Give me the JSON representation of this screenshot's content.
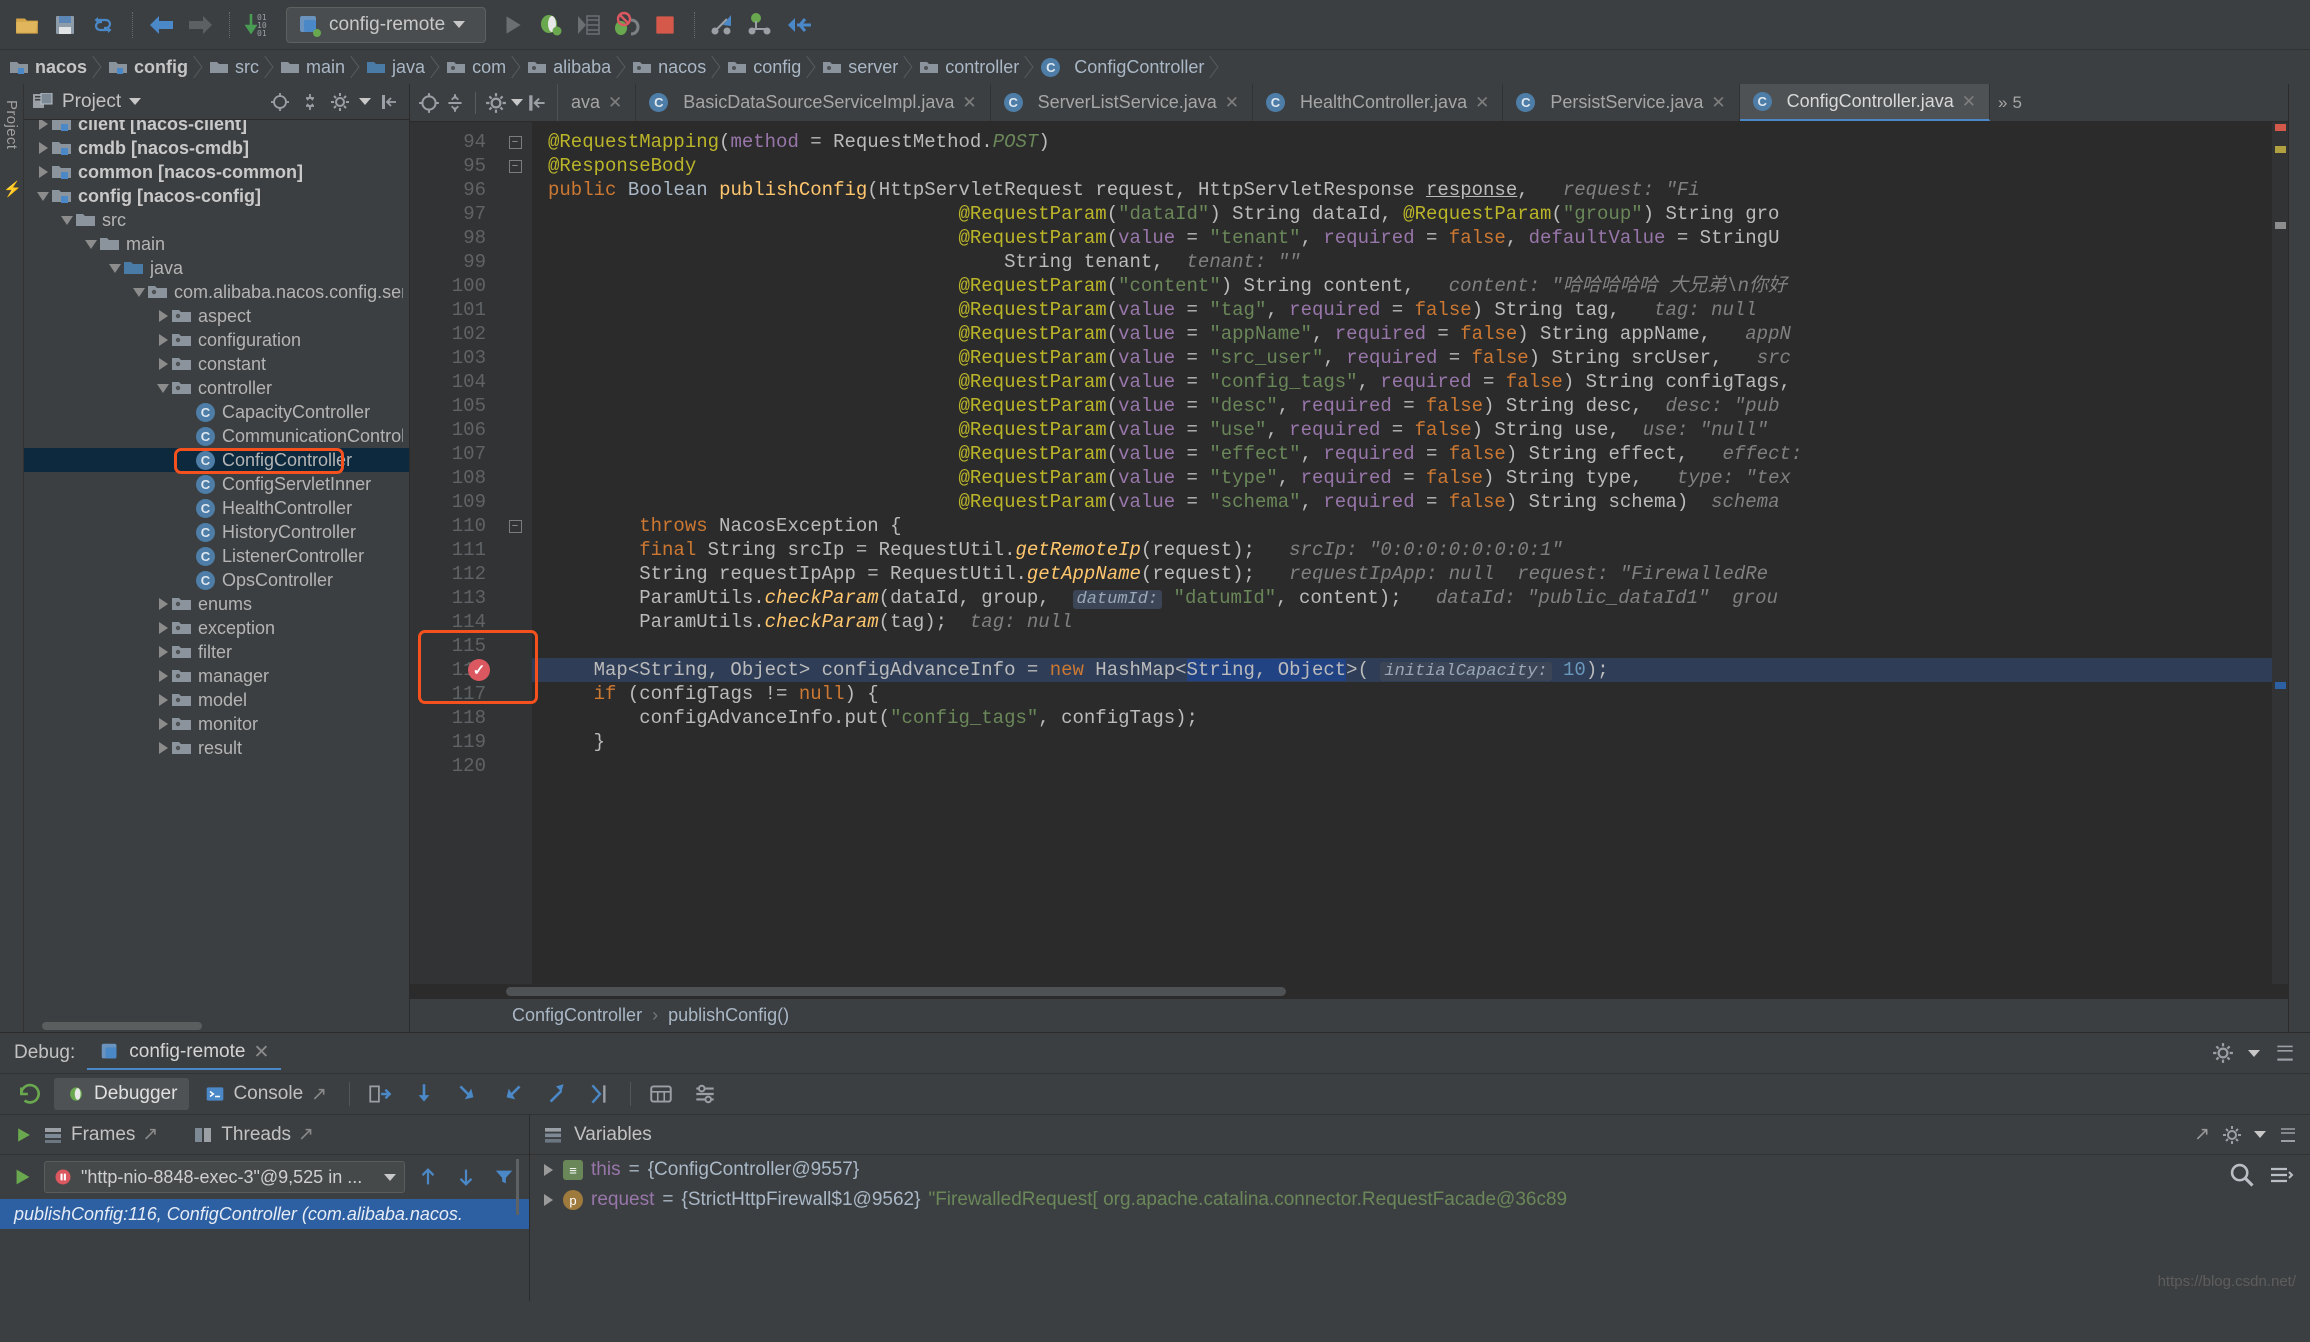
{
  "toolbar": {
    "run_config_label": "config-remote",
    "icons": [
      "open-folder-icon",
      "save-all-icon",
      "sync-icon",
      "back-icon",
      "forward-icon",
      "compile-icon",
      "run-config-selector",
      "run-icon",
      "debug-icon",
      "coverage-icon",
      "mute-breakpoints-icon",
      "stop-icon",
      "step-into-icon",
      "step-over-icon",
      "step-out-icon"
    ]
  },
  "breadcrumb": {
    "items": [
      {
        "label": "nacos",
        "icon": "module-folder-icon",
        "bold": true
      },
      {
        "label": "config",
        "icon": "module-folder-icon",
        "bold": true
      },
      {
        "label": "src",
        "icon": "folder-icon",
        "bold": false
      },
      {
        "label": "main",
        "icon": "folder-icon",
        "bold": false
      },
      {
        "label": "java",
        "icon": "source-folder-icon",
        "bold": false
      },
      {
        "label": "com",
        "icon": "package-icon",
        "bold": false
      },
      {
        "label": "alibaba",
        "icon": "package-icon",
        "bold": false
      },
      {
        "label": "nacos",
        "icon": "package-icon",
        "bold": false
      },
      {
        "label": "config",
        "icon": "package-icon",
        "bold": false
      },
      {
        "label": "server",
        "icon": "package-icon",
        "bold": false
      },
      {
        "label": "controller",
        "icon": "package-icon",
        "bold": false
      },
      {
        "label": "ConfigController",
        "icon": "class-icon",
        "bold": false
      }
    ]
  },
  "project_panel": {
    "title": "Project",
    "tree": [
      {
        "label": "client [nacos-client]",
        "indent": 0,
        "twist": "right",
        "icon": "module-folder-icon",
        "bold": true,
        "clipped": true
      },
      {
        "label": "cmdb [nacos-cmdb]",
        "indent": 0,
        "twist": "right",
        "icon": "module-folder-icon",
        "bold": true
      },
      {
        "label": "common [nacos-common]",
        "indent": 0,
        "twist": "right",
        "icon": "module-folder-icon",
        "bold": true
      },
      {
        "label": "config [nacos-config]",
        "indent": 0,
        "twist": "down",
        "icon": "module-folder-icon",
        "bold": true
      },
      {
        "label": "src",
        "indent": 1,
        "twist": "down",
        "icon": "folder-icon",
        "bold": false
      },
      {
        "label": "main",
        "indent": 2,
        "twist": "down",
        "icon": "folder-icon",
        "bold": false
      },
      {
        "label": "java",
        "indent": 3,
        "twist": "down",
        "icon": "source-folder-icon",
        "bold": false
      },
      {
        "label": "com.alibaba.nacos.config.serve",
        "indent": 4,
        "twist": "down",
        "icon": "package-icon",
        "bold": false
      },
      {
        "label": "aspect",
        "indent": 5,
        "twist": "right",
        "icon": "package-icon",
        "bold": false
      },
      {
        "label": "configuration",
        "indent": 5,
        "twist": "right",
        "icon": "package-icon",
        "bold": false
      },
      {
        "label": "constant",
        "indent": 5,
        "twist": "right",
        "icon": "package-icon",
        "bold": false
      },
      {
        "label": "controller",
        "indent": 5,
        "twist": "down",
        "icon": "package-icon",
        "bold": false
      },
      {
        "label": "CapacityController",
        "indent": 6,
        "twist": "none",
        "icon": "class-icon",
        "bold": false
      },
      {
        "label": "CommunicationController",
        "indent": 6,
        "twist": "none",
        "icon": "class-icon",
        "bold": false
      },
      {
        "label": "ConfigController",
        "indent": 6,
        "twist": "none",
        "icon": "class-icon",
        "bold": false,
        "selected": true
      },
      {
        "label": "ConfigServletInner",
        "indent": 6,
        "twist": "none",
        "icon": "class-icon",
        "bold": false
      },
      {
        "label": "HealthController",
        "indent": 6,
        "twist": "none",
        "icon": "class-icon",
        "bold": false
      },
      {
        "label": "HistoryController",
        "indent": 6,
        "twist": "none",
        "icon": "class-icon",
        "bold": false
      },
      {
        "label": "ListenerController",
        "indent": 6,
        "twist": "none",
        "icon": "class-icon",
        "bold": false
      },
      {
        "label": "OpsController",
        "indent": 6,
        "twist": "none",
        "icon": "class-icon",
        "bold": false
      },
      {
        "label": "enums",
        "indent": 5,
        "twist": "right",
        "icon": "package-icon",
        "bold": false
      },
      {
        "label": "exception",
        "indent": 5,
        "twist": "right",
        "icon": "package-icon",
        "bold": false
      },
      {
        "label": "filter",
        "indent": 5,
        "twist": "right",
        "icon": "package-icon",
        "bold": false
      },
      {
        "label": "manager",
        "indent": 5,
        "twist": "right",
        "icon": "package-icon",
        "bold": false
      },
      {
        "label": "model",
        "indent": 5,
        "twist": "right",
        "icon": "package-icon",
        "bold": false
      },
      {
        "label": "monitor",
        "indent": 5,
        "twist": "right",
        "icon": "package-icon",
        "bold": false
      },
      {
        "label": "result",
        "indent": 5,
        "twist": "right",
        "icon": "package-icon",
        "bold": false
      }
    ]
  },
  "editor_tabs": [
    {
      "label": "ava",
      "icon": "class-icon",
      "active": false,
      "clipped": true
    },
    {
      "label": "BasicDataSourceServiceImpl.java",
      "icon": "class-icon",
      "active": false
    },
    {
      "label": "ServerListService.java",
      "icon": "class-icon",
      "active": false
    },
    {
      "label": "HealthController.java",
      "icon": "class-icon",
      "active": false
    },
    {
      "label": "PersistService.java",
      "icon": "class-icon",
      "active": false
    },
    {
      "label": "ConfigController.java",
      "icon": "class-icon",
      "active": true
    }
  ],
  "editor_tabs_overflow": "5",
  "code": {
    "first_line": 94,
    "execution_line": 116,
    "lines": [
      {
        "n": 94,
        "fold": "minus",
        "html": "<span class='ann'>@RequestMapping</span>(<span class='pv'>method</span> = RequestMethod.<span class='hint'>POST</span>)"
      },
      {
        "n": 95,
        "fold": "end",
        "html": "<span class='ann'>@ResponseBody</span>"
      },
      {
        "n": 96,
        "fold": "",
        "html": "<span class='kw'>public</span> <span class='typ'>Boolean</span> <span class='mth'>publishConfig</span>(HttpServletRequest request, HttpServletResponse <u>response</u>,   <span class='hintg'>request: \"Fi</span>"
      },
      {
        "n": 97,
        "fold": "",
        "html": "                                    <span class='ann'>@RequestParam</span>(<span class='str'>\"dataId\"</span>) String dataId, <span class='ann'>@RequestParam</span>(<span class='str'>\"group\"</span>) String gro"
      },
      {
        "n": 98,
        "fold": "",
        "html": "                                    <span class='ann'>@RequestParam</span>(<span class='pv'>value</span> = <span class='str'>\"tenant\"</span>, <span class='pv'>required</span> = <span class='kw'>false</span>, <span class='pv'>defaultValue</span> = StringU"
      },
      {
        "n": 99,
        "fold": "",
        "html": "                                        String tenant,  <span class='hintg'>tenant: \"\"</span>"
      },
      {
        "n": 100,
        "fold": "",
        "html": "                                    <span class='ann'>@RequestParam</span>(<span class='str'>\"content\"</span>) String content,   <span class='hintg'>content: \"哈哈哈哈哈 大兄弟\\n你好</span>"
      },
      {
        "n": 101,
        "fold": "",
        "html": "                                    <span class='ann'>@RequestParam</span>(<span class='pv'>value</span> = <span class='str'>\"tag\"</span>, <span class='pv'>required</span> = <span class='kw'>false</span>) String tag,   <span class='hintg'>tag: null</span>"
      },
      {
        "n": 102,
        "fold": "",
        "html": "                                    <span class='ann'>@RequestParam</span>(<span class='pv'>value</span> = <span class='str'>\"appName\"</span>, <span class='pv'>required</span> = <span class='kw'>false</span>) String appName,   <span class='hintg'>appN</span>"
      },
      {
        "n": 103,
        "fold": "",
        "html": "                                    <span class='ann'>@RequestParam</span>(<span class='pv'>value</span> = <span class='str'>\"src_user\"</span>, <span class='pv'>required</span> = <span class='kw'>false</span>) String srcUser,   <span class='hintg'>src</span>"
      },
      {
        "n": 104,
        "fold": "",
        "html": "                                    <span class='ann'>@RequestParam</span>(<span class='pv'>value</span> = <span class='str'>\"config_tags\"</span>, <span class='pv'>required</span> = <span class='kw'>false</span>) String configTags,"
      },
      {
        "n": 105,
        "fold": "",
        "html": "                                    <span class='ann'>@RequestParam</span>(<span class='pv'>value</span> = <span class='str'>\"desc\"</span>, <span class='pv'>required</span> = <span class='kw'>false</span>) String desc,  <span class='hintg'>desc: \"pub</span>"
      },
      {
        "n": 106,
        "fold": "",
        "html": "                                    <span class='ann'>@RequestParam</span>(<span class='pv'>value</span> = <span class='str'>\"use\"</span>, <span class='pv'>required</span> = <span class='kw'>false</span>) String use,  <span class='hintg'>use: \"null\"</span>"
      },
      {
        "n": 107,
        "fold": "",
        "html": "                                    <span class='ann'>@RequestParam</span>(<span class='pv'>value</span> = <span class='str'>\"effect\"</span>, <span class='pv'>required</span> = <span class='kw'>false</span>) String effect,   <span class='hintg'>effect:</span>"
      },
      {
        "n": 108,
        "fold": "",
        "html": "                                    <span class='ann'>@RequestParam</span>(<span class='pv'>value</span> = <span class='str'>\"type\"</span>, <span class='pv'>required</span> = <span class='kw'>false</span>) String type,   <span class='hintg'>type: \"tex</span>"
      },
      {
        "n": 109,
        "fold": "",
        "html": "                                    <span class='ann'>@RequestParam</span>(<span class='pv'>value</span> = <span class='str'>\"schema\"</span>, <span class='pv'>required</span> = <span class='kw'>false</span>) String schema)  <span class='hintg'>schema</span>"
      },
      {
        "n": 110,
        "fold": "minus",
        "html": "        <span class='kw'>throws</span> NacosException {"
      },
      {
        "n": 111,
        "fold": "",
        "html": "        <span class='kw'>final</span> String srcIp = RequestUtil.<span class='mth'><i>getRemoteIp</i></span>(request);   <span class='hintg'>srcIp: \"0:0:0:0:0:0:0:1\"</span>"
      },
      {
        "n": 112,
        "fold": "",
        "html": "        String requestIpApp = RequestUtil.<span class='mth'><i>getAppName</i></span>(request);   <span class='hintg'>requestIpApp: null  request: \"FirewalledRe</span>"
      },
      {
        "n": 113,
        "fold": "",
        "html": "        ParamUtils.<span class='mth'><i>checkParam</i></span>(dataId, group,  <span class='inlay'>datumId:</span> <span class='str'>\"datumId\"</span>, content);   <span class='hintg'>dataId: \"public_dataId1\"  grou</span>"
      },
      {
        "n": 114,
        "fold": "",
        "html": "        ParamUtils.<span class='mth'><i>checkParam</i></span>(tag);  <span class='hintg'>tag: null</span>"
      },
      {
        "n": 115,
        "fold": "",
        "html": ""
      },
      {
        "n": 116,
        "fold": "",
        "exec": true,
        "html": "    Map&lt;String, Object&gt; configAdvanceInfo = <span class='kw'>new</span> HashMap&lt;<span class='sel'>String, Object</span>&gt;( <span class='inlay'>initialCapacity:</span> <span class='num'>10</span>);"
      },
      {
        "n": 117,
        "fold": "",
        "html": "    <span class='kw'>if</span> (configTags != <span class='kw'>null</span>) {"
      },
      {
        "n": 118,
        "fold": "",
        "html": "        configAdvanceInfo.put(<span class='str'>\"config_tags\"</span>, configTags);"
      },
      {
        "n": 119,
        "fold": "",
        "html": "    }"
      },
      {
        "n": 120,
        "fold": "",
        "html": ""
      }
    ]
  },
  "editor_breadcrumb": {
    "class": "ConfigController",
    "method": "publishConfig()",
    "separator": "›"
  },
  "debug": {
    "label": "Debug:",
    "session": "config-remote",
    "tabs": [
      {
        "label": "Debugger",
        "icon": "debugger-icon",
        "active": true
      },
      {
        "label": "Console",
        "icon": "console-icon",
        "active": false,
        "pin": "↗"
      }
    ],
    "frames_header": "Frames",
    "threads_header": "Threads",
    "variables_header": "Variables",
    "thread_selected": "\"http-nio-8848-exec-3\"@9,525 in ...",
    "stack_frame": "publishConfig:116, ConfigController (com.alibaba.nacos.",
    "variables": [
      {
        "icon": "this",
        "badge": "≡",
        "name": "this",
        "eq": "=",
        "value": "{ConfigController@9557}"
      },
      {
        "icon": "p",
        "badge": "p",
        "name": "request",
        "eq": "=",
        "value": "{StrictHttpFirewall$1@9562}",
        "str": "\"FirewalledRequest[ org.apache.catalina.connector.RequestFacade@36c89"
      }
    ]
  },
  "watermark": "https://blog.csdn.net/"
}
